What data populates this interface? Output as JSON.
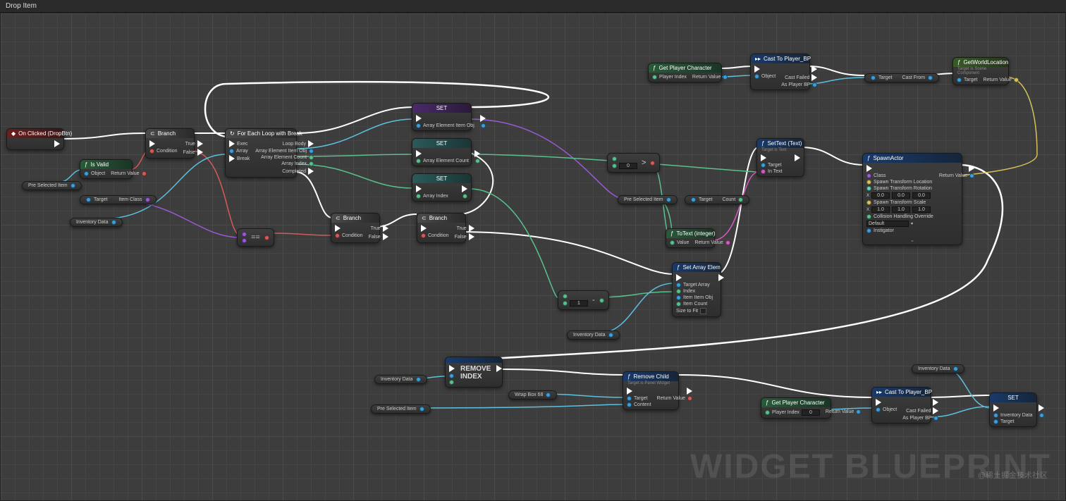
{
  "title": "Drop Item",
  "watermark": "WIDGET BLUEPRINT",
  "credit": "@稀土掘金技术社区",
  "nodes": {
    "onClicked": {
      "title": "On Clicked (DropBtn)"
    },
    "isValid": {
      "title": "Is Valid",
      "pins": {
        "object": "Object",
        "ret": "Return Value"
      }
    },
    "branch1": {
      "title": "Branch",
      "pins": {
        "cond": "Condition",
        "t": "True",
        "f": "False"
      }
    },
    "branch2": {
      "title": "Branch",
      "pins": {
        "cond": "Condition",
        "t": "True",
        "f": "False"
      }
    },
    "branch3": {
      "title": "Branch",
      "pins": {
        "cond": "Condition",
        "t": "True",
        "f": "False"
      }
    },
    "foreach": {
      "title": "For Each Loop with Break",
      "pins": {
        "exec": "Exec",
        "array": "Array",
        "brk": "Break",
        "body": "Loop Body",
        "elemObj": "Array Element Item Obj",
        "elemCount": "Array Element Count",
        "idx": "Array Index",
        "done": "Completed"
      }
    },
    "set1": {
      "title": "SET",
      "pins": {
        "p": "Array Element Item Obj"
      }
    },
    "set2": {
      "title": "SET",
      "pins": {
        "p": "Array Element Count"
      }
    },
    "set3": {
      "title": "SET",
      "pins": {
        "p": "Array Index"
      }
    },
    "set4": {
      "title": "SET",
      "pins": {
        "p": "Inventory Data",
        "t": "Target"
      }
    },
    "getPlayerChar1": {
      "title": "Get Player Character",
      "pins": {
        "idx": "Player Index",
        "ret": "Return Value"
      }
    },
    "getPlayerChar2": {
      "title": "Get Player Character",
      "pins": {
        "idx": "Player Index",
        "ret": "Return Value"
      }
    },
    "castPlayer1": {
      "title": "Cast To Player_BP",
      "pins": {
        "obj": "Object",
        "fail": "Cast Failed",
        "as": "As Player BP"
      }
    },
    "castPlayer2": {
      "title": "Cast To Player_BP",
      "pins": {
        "obj": "Object",
        "fail": "Cast Failed",
        "as": "As Player BP"
      }
    },
    "getWorldLoc": {
      "title": "GetWorldLocation",
      "sub": "Target is Scene Component",
      "pins": {
        "tgt": "Target",
        "ret": "Return Value"
      }
    },
    "setText": {
      "title": "SetText (Text)",
      "sub": "Target is Text",
      "pins": {
        "tgt": "Target",
        "txt": "In Text"
      }
    },
    "toText": {
      "title": "ToText (integer)",
      "pins": {
        "val": "Value",
        "ret": "Return Value"
      }
    },
    "setArrayElem": {
      "title": "Set Array Elem",
      "pins": {
        "arr": "Target Array",
        "idx": "Index",
        "itemObj": "Item Item Obj",
        "itemCount": "Item Count",
        "size": "Size to Fit"
      }
    },
    "removeIndex": {
      "title": "REMOVE INDEX"
    },
    "removeChild": {
      "title": "Remove Child",
      "sub": "Target is Panel Widget",
      "pins": {
        "tgt": "Target",
        "cnt": "Content",
        "ret": "Return Value"
      }
    },
    "spawnActor": {
      "title": "SpawnActor",
      "pins": {
        "cls": "Class",
        "loc": "Spawn Transform Location",
        "rot": "Spawn Transform Rotation",
        "scl": "Spawn Transform Scale",
        "col": "Collision Handling Override",
        "inst": "Instigator",
        "ret": "Return Value"
      }
    },
    "targetCastFrom": {
      "pins": {
        "tgt": "Target",
        "cf": "Cast From"
      }
    },
    "targetCount": {
      "pins": {
        "tgt": "Target",
        "cnt": "Count"
      }
    },
    "targetItemClass": {
      "pins": {
        "tgt": "Target",
        "ic": "Item Class"
      }
    }
  },
  "vars": {
    "preSelected1": "Pre Selected Item",
    "preSelected2": "Pre Selected Item",
    "preSelected3": "Pre Selected Item",
    "inventoryData1": "Inventory Data",
    "inventoryData2": "Inventory Data",
    "inventoryData3": "Inventory Data",
    "inventoryData4": "Inventory Data",
    "wrapBox": "Wrap Box 68"
  },
  "ops": {
    "eq": "==",
    "sub": "-",
    "gt": ">",
    "subVal": "1",
    "gtVal": "0"
  },
  "inputs": {
    "rot": {
      "x": "0.0",
      "y": "0.0",
      "z": "0.0"
    },
    "scl": {
      "x": "1.0",
      "y": "1.0",
      "z": "1.0"
    },
    "collision": "Default",
    "playerIdx": "0"
  }
}
